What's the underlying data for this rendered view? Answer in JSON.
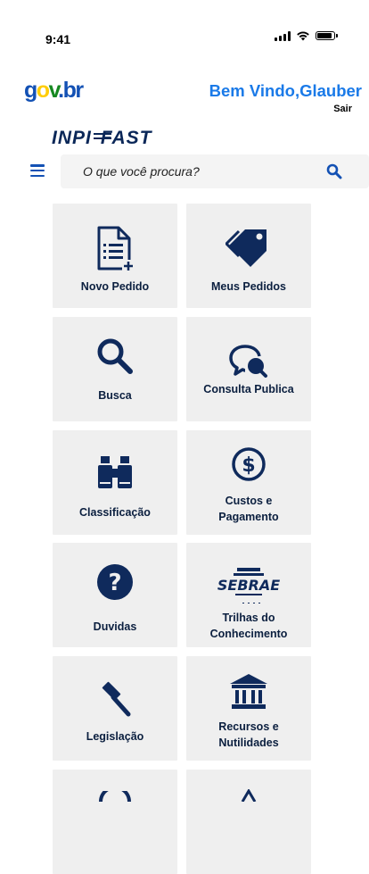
{
  "status": {
    "time": "9:41"
  },
  "header": {
    "logo": {
      "g": "g",
      "o": "o",
      "v": "v",
      "dot": ".",
      "b": "b",
      "r": "r"
    },
    "welcome": "Bem Vindo,Glauber",
    "logout": "Sair"
  },
  "brand": {
    "inpi": "INPI",
    "fast": "FAST"
  },
  "search": {
    "placeholder": "O que você procura?"
  },
  "tiles": [
    {
      "label": "Novo Pedido",
      "icon": "new-document-icon"
    },
    {
      "label": "Meus Pedidos",
      "icon": "tag-icon"
    },
    {
      "label": "Busca",
      "icon": "magnifier-icon"
    },
    {
      "label": "Consulta Publica",
      "icon": "chat-search-icon"
    },
    {
      "label": "Classificação",
      "icon": "binoculars-icon"
    },
    {
      "label_line1": "Custos e",
      "label_line2": "Pagamento",
      "icon": "dollar-coin-icon"
    },
    {
      "label": "Duvidas",
      "icon": "question-icon"
    },
    {
      "label_line1": "Trilhas do",
      "label_line2": "Conhecimento",
      "icon": "sebrae-logo",
      "logo_text": "SEBRAE"
    },
    {
      "label": "Legislação",
      "icon": "gavel-icon"
    },
    {
      "label_line1": "Recursos e",
      "label_line2": "Nutilidades",
      "icon": "bank-icon"
    }
  ],
  "colors": {
    "primary": "#0f2a5c",
    "accent": "#1351b4",
    "welcome": "#1a7ae8",
    "tile_bg": "#efefef"
  }
}
